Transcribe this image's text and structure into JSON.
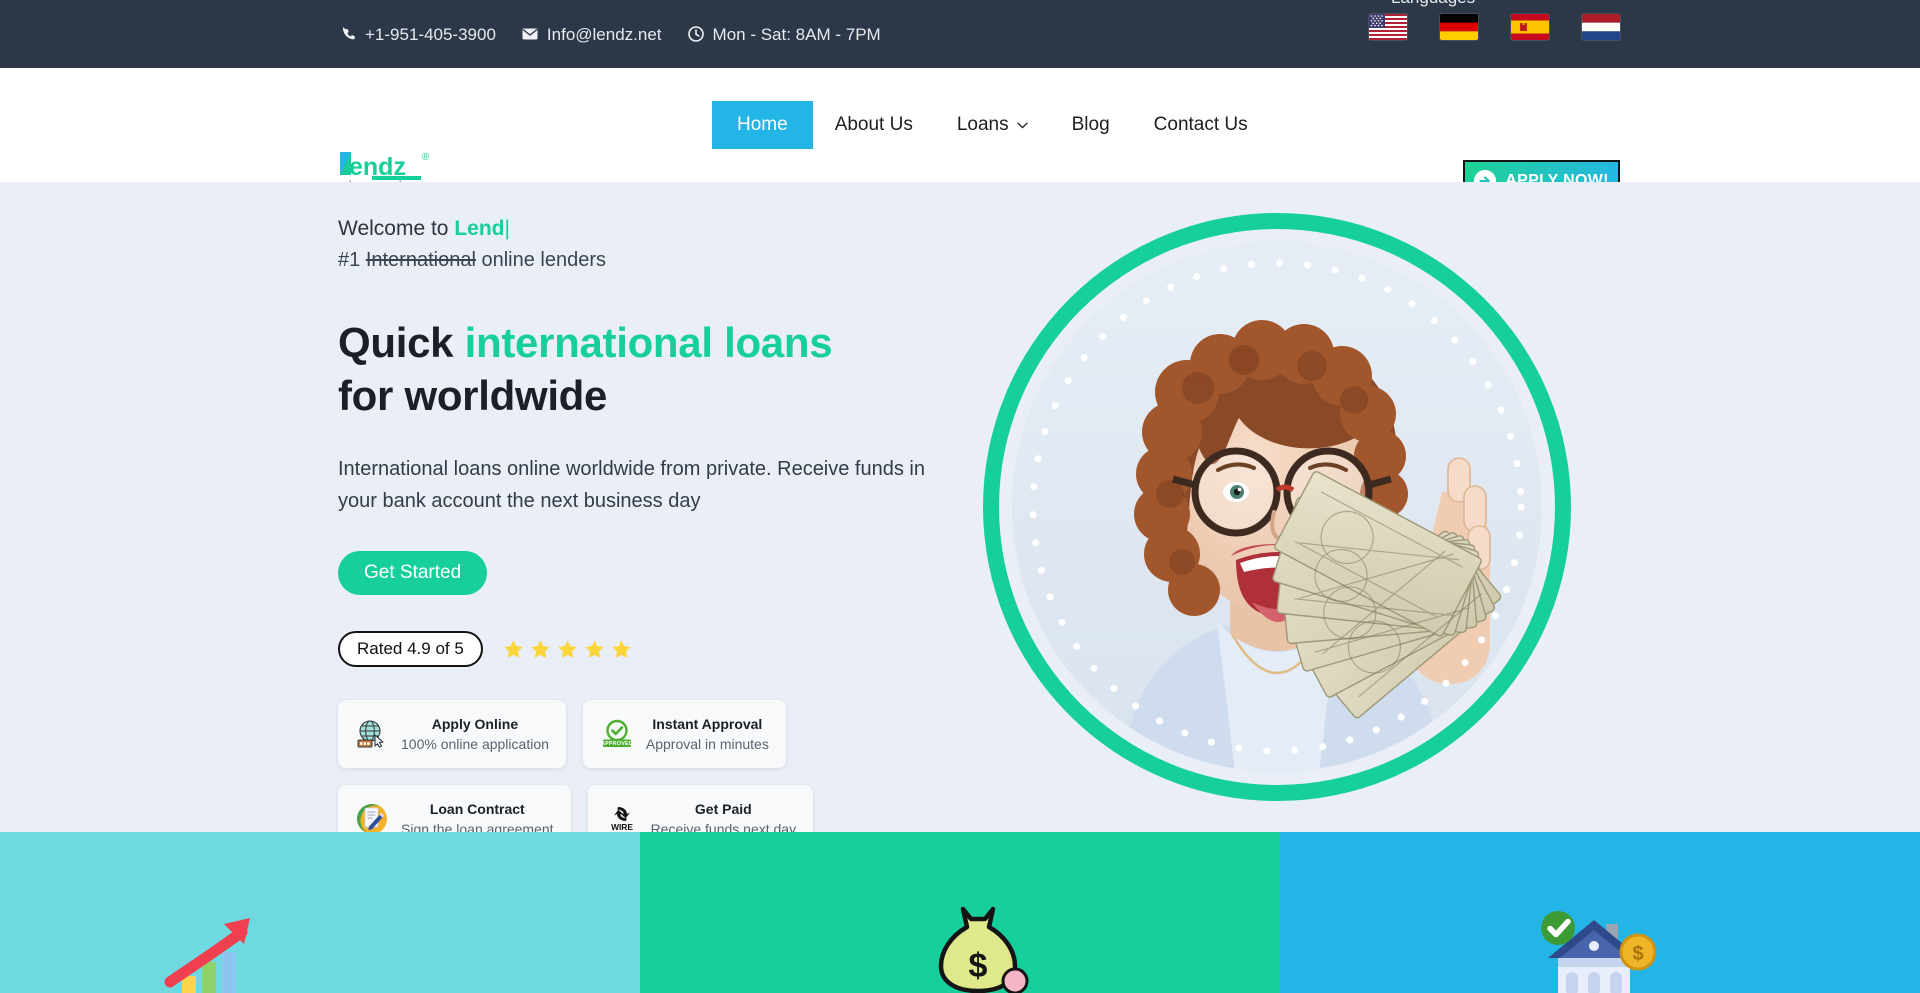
{
  "topbar": {
    "contacts": [
      {
        "icon": "phone-icon",
        "text": "+1-951-405-3900"
      },
      {
        "icon": "envelope-icon",
        "text": "Info@lendz.net"
      },
      {
        "icon": "clock-icon",
        "text": "Mon - Sat: 8AM - 7PM"
      }
    ],
    "languages_label": "Languages",
    "flags": [
      {
        "name": "flag-united-states",
        "code": "US"
      },
      {
        "name": "flag-germany",
        "code": "DE"
      },
      {
        "name": "flag-spain",
        "code": "ES"
      },
      {
        "name": "flag-netherlands",
        "code": "NL"
      }
    ],
    "background": "#2c3748"
  },
  "header": {
    "logo": {
      "name": "lendz-logo",
      "text": "Lendz",
      "registered": "®",
      "tagline": "Loans made easy"
    },
    "nav": [
      {
        "label": "Home",
        "active": true
      },
      {
        "label": "About Us",
        "active": false
      },
      {
        "label": "Loans",
        "active": false,
        "has_dropdown": true
      },
      {
        "label": "Blog",
        "active": false
      },
      {
        "label": "Contact Us",
        "active": false
      }
    ],
    "apply_button": {
      "label": "APPLY NOW!",
      "icon": "arrow-right-circle-icon"
    },
    "active_color": "#22b5e6"
  },
  "hero": {
    "welcome_prefix": "Welcome to ",
    "welcome_accent": "Lend",
    "welcome_caret": "|",
    "sub_prefix": "#1 ",
    "sub_strike": "International",
    "sub_suffix": " online lenders",
    "headline_line1_dark": "Quick ",
    "headline_line1_green": "international loans",
    "headline_line2": "for worldwide",
    "lead": "International loans online worldwide from private. Receive funds in your bank account the next business day",
    "cta_label": "Get Started",
    "rating_label": "Rated 4.9 of 5",
    "stars": 5,
    "accent_color": "#16cf9a",
    "background": "#eaeff7",
    "image": {
      "name": "happy-woman-holding-cash-photo",
      "alt": "Smiling woman with glasses holding a fan of dollar bills"
    },
    "cards": [
      {
        "icon": "globe-cursor-icon",
        "title": "Apply Online",
        "desc": "100% online application"
      },
      {
        "icon": "approved-badge-icon",
        "title": "Instant Approval",
        "desc": "Approval in minutes"
      },
      {
        "icon": "contract-signing-icon",
        "title": "Loan Contract",
        "desc": "Sign the loan agreement"
      },
      {
        "icon": "wire-transfer-icon",
        "title": "Get Paid",
        "desc": "Receive funds next day"
      }
    ]
  },
  "panels": [
    {
      "name": "growth-chart-panel",
      "icon": "growth-arrow-chart-icon",
      "color": "#6ed9e0"
    },
    {
      "name": "money-bag-panel",
      "icon": "money-bag-icon",
      "color": "#16cf9a"
    },
    {
      "name": "home-loan-panel",
      "icon": "approved-house-coin-icon",
      "color": "#22b5e6"
    }
  ]
}
